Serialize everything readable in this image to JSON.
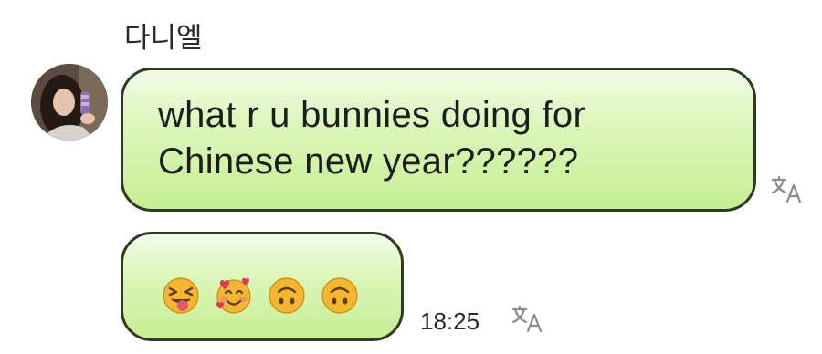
{
  "chat": {
    "sender_name": "다니엘",
    "avatar": {
      "icon": "profile-photo"
    },
    "messages": [
      {
        "text": "what r u bunnies doing for\nChinese new year??????",
        "translate_icon": "translate-icon"
      },
      {
        "emojis": [
          "squinting-tongue-face",
          "smiling-face-with-hearts",
          "upside-down-face",
          "upside-down-face"
        ],
        "time": "18:25",
        "translate_icon": "translate-icon"
      }
    ]
  },
  "colors": {
    "bubble_top": "#f4fce8",
    "bubble_bottom": "#c6ef92",
    "bubble_border": "#2f3a26",
    "emoji_yellow": "#f3b62e"
  }
}
